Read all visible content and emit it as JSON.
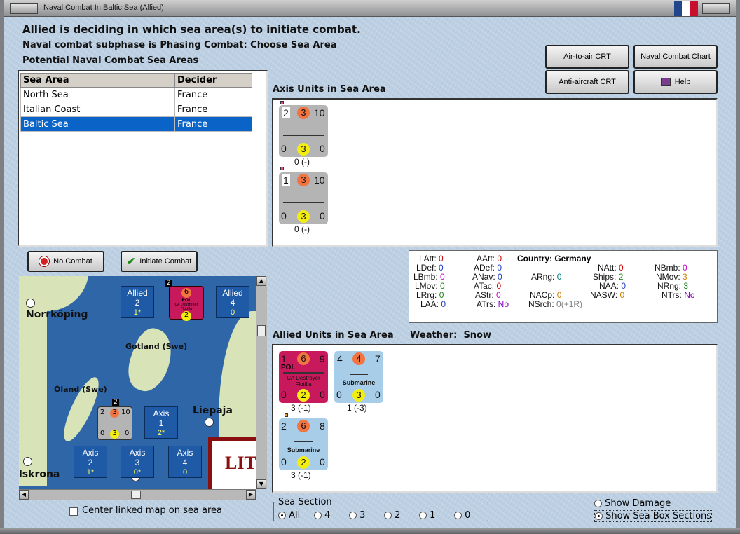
{
  "window": {
    "title": "Naval Combat In Baltic Sea (Allied)"
  },
  "header": {
    "line1": "Allied is deciding in which sea area(s) to initiate combat.",
    "line2": "Naval combat subphase is Phasing Combat: Choose Sea Area",
    "line3": "Potential Naval Combat Sea Areas"
  },
  "buttons": {
    "air_to_air": "Air-to-air CRT",
    "naval_chart": "Naval Combat Chart",
    "anti_aircraft": "Anti-aircraft CRT",
    "help": "Help",
    "no_combat": "No Combat",
    "initiate_combat": "Initiate Combat"
  },
  "sea_table": {
    "headers": [
      "Sea Area",
      "Decider"
    ],
    "rows": [
      {
        "area": "North Sea",
        "decider": "France"
      },
      {
        "area": "Italian Coast",
        "decider": "France"
      },
      {
        "area": "Baltic Sea",
        "decider": "France"
      }
    ],
    "selected": "Baltic Sea"
  },
  "axis_section": {
    "label": "Axis Units in Sea Area",
    "units": [
      {
        "tl": "2",
        "tc": "3",
        "tr": "10",
        "bl": "0",
        "bc": "3",
        "br": "0",
        "under": "0 (-)"
      },
      {
        "tl": "1",
        "tc": "3",
        "tr": "10",
        "bl": "0",
        "bc": "3",
        "br": "0",
        "under": "0 (-)"
      }
    ]
  },
  "stats": {
    "country_label": "Country:",
    "country": "Germany",
    "colors": {
      "red": "#cc0000",
      "blue": "#1a3fc4",
      "magenta": "#cc00cc",
      "green": "#208020",
      "orange": "#d08000",
      "purple": "#8000c0",
      "teal": "#008080",
      "grey": "#808080"
    },
    "col1": [
      [
        "LAtt:",
        "0"
      ],
      [
        "LDef:",
        "0"
      ],
      [
        "LBmb:",
        "0"
      ],
      [
        "LMov:",
        "0"
      ],
      [
        "LRrg:",
        "0"
      ],
      [
        "LAA:",
        "0"
      ]
    ],
    "col2": [
      [
        "AAtt:",
        "0"
      ],
      [
        "ADef:",
        "0"
      ],
      [
        "ANav:",
        "0"
      ],
      [
        "ATac:",
        "0"
      ],
      [
        "AStr:",
        "0"
      ],
      [
        "ATrs:",
        "No"
      ]
    ],
    "col3": [
      [
        "ARng:",
        "0"
      ],
      [
        "NACp:",
        "0"
      ],
      [
        "NSrch:",
        "0(+1R)"
      ]
    ],
    "col4": [
      [
        "NAtt:",
        "0"
      ],
      [
        "Ships:",
        "2"
      ],
      [
        "NAA:",
        "0"
      ],
      [
        "NASW:",
        "0"
      ]
    ],
    "col5": [
      [
        "NBmb:",
        "0"
      ],
      [
        "NMov:",
        "3"
      ],
      [
        "NRng:",
        "3"
      ],
      [
        "NTrs:",
        "No"
      ]
    ]
  },
  "allied_section": {
    "label": "Allied Units in Sea Area",
    "weather_label": "Weather:",
    "weather": "Snow",
    "units": [
      {
        "tl": "1",
        "tc": "6",
        "tr": "9",
        "bl": "0",
        "bc": "2",
        "br": "0",
        "nation": "POL",
        "name": "CA Destroyer Flotilla",
        "under": "3 (-1)"
      },
      {
        "tl": "4",
        "tc": "4",
        "tr": "7",
        "bl": "0",
        "bc": "3",
        "br": "0",
        "name": "Submarine",
        "under": "1 (-3)"
      },
      {
        "tl": "2",
        "tc": "6",
        "tr": "8",
        "bl": "0",
        "bc": "2",
        "br": "0",
        "name": "Submarine",
        "under": "3 (-1)"
      }
    ]
  },
  "map": {
    "cities": [
      "Norrköping",
      "Liepaja",
      "lskrona"
    ],
    "places": [
      "Gotland (Swe)",
      "Öland (Swe)"
    ],
    "lit_label": "LIT",
    "zones": [
      {
        "side": "Allied",
        "num": "2",
        "sub": "1*"
      },
      {
        "side": "Allied",
        "num": "4",
        "sub": "0"
      },
      {
        "side": "Axis",
        "num": "1",
        "sub": "2*"
      },
      {
        "side": "Axis",
        "num": "2",
        "sub": "1*"
      },
      {
        "side": "Axis",
        "num": "3",
        "sub": "0*"
      },
      {
        "side": "Axis",
        "num": "4",
        "sub": "0"
      }
    ],
    "map_counter_pink": {
      "badge": "2",
      "tl": "6",
      "bc": "2",
      "nation": "POL",
      "name": "CA Destroyer Flotilla"
    },
    "map_counter_grey": {
      "badge": "2",
      "tl": "2",
      "tc": "3",
      "tr": "10",
      "bl": "0",
      "bc": "3",
      "br": "0"
    }
  },
  "center_checkbox": "Center linked map on sea area",
  "sea_section": {
    "legend": "Sea Section",
    "options": [
      "All",
      "4",
      "3",
      "2",
      "1",
      "0"
    ],
    "selected": "All"
  },
  "display_options": {
    "show_damage": "Show Damage",
    "show_sea_box": "Show Sea Box Sections",
    "selected": "Show Sea Box Sections"
  }
}
